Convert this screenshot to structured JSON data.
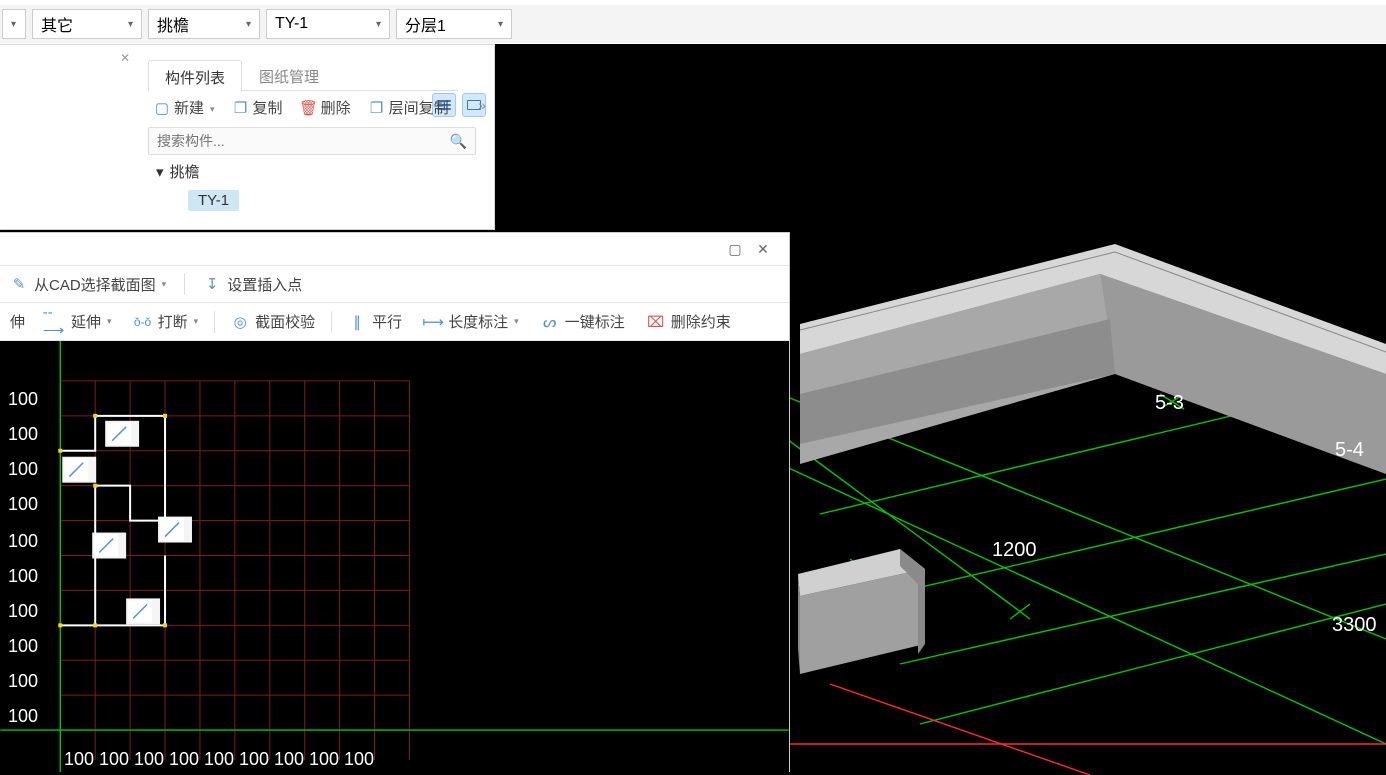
{
  "dropdowns": {
    "d1": "其它",
    "d2": "挑檐",
    "d3": "TY-1",
    "d4": "分层1"
  },
  "left": {
    "tab1": "构件列表",
    "tab2": "图纸管理",
    "btn_new": "新建",
    "btn_copy": "复制",
    "btn_delete": "删除",
    "btn_floorcopy": "层间复制",
    "search_ph": "搜索构件...",
    "tree_root": "挑檐",
    "tree_item": "TY-1"
  },
  "editor": {
    "t1_cad": "从CAD选择截面图",
    "t1_insert": "设置插入点",
    "t2_0": "伸",
    "t2_extend": "延伸",
    "t2_break": "打断",
    "t2_check": "截面校验",
    "t2_parallel": "平行",
    "t2_dim": "长度标注",
    "t2_onekey": "一键标注",
    "t2_delcon": "删除约束"
  },
  "grid_y": [
    "100",
    "100",
    "100",
    "100",
    "100",
    "100",
    "100",
    "100",
    "100",
    "100"
  ],
  "grid_x": [
    "100",
    "100",
    "100",
    "100",
    "100",
    "100",
    "100",
    "100",
    "100"
  ],
  "labels3d": {
    "p53": "5-3",
    "p54": "5-4",
    "d1200": "1200",
    "d3300": "3300"
  }
}
